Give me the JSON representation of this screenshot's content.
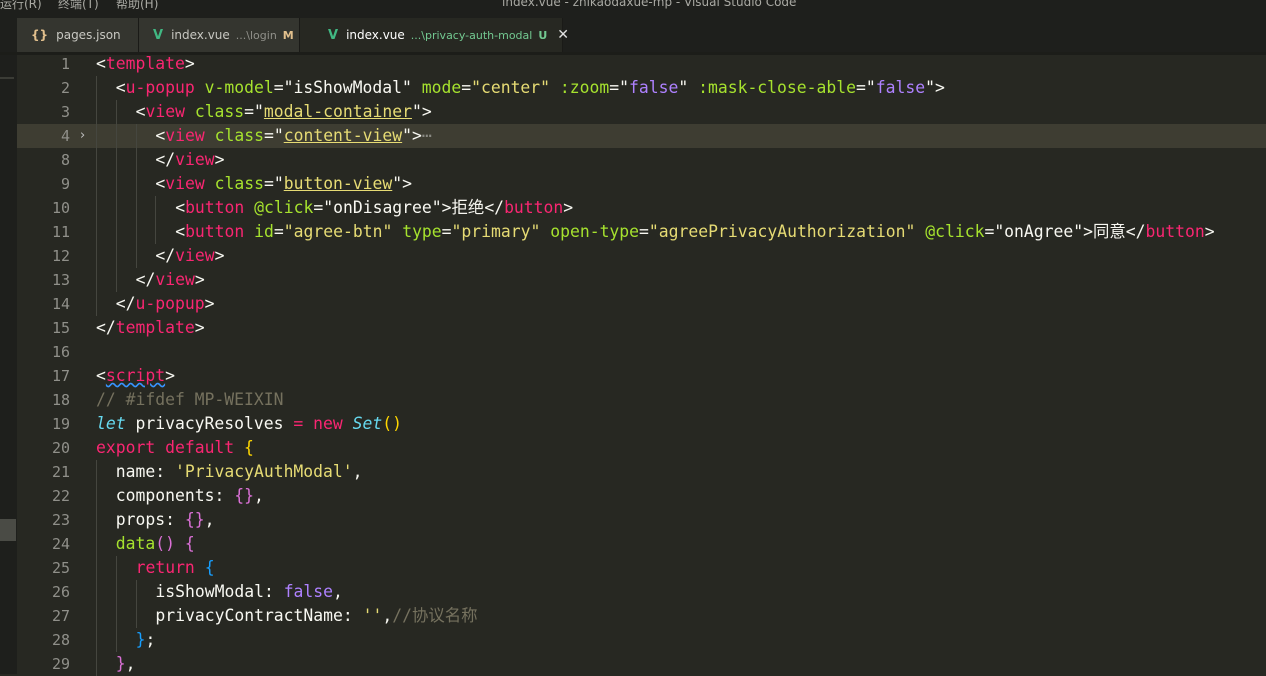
{
  "window": {
    "title": "index.vue - zhikaodaxue-mp - Visual Studio Code"
  },
  "menu": [
    "运行(R)",
    "终端(T)",
    "帮助(H)"
  ],
  "tabs": [
    {
      "icon": "json-braces-icon",
      "name": "pages.json",
      "path": "",
      "badge": "",
      "close": ""
    },
    {
      "icon": "vue-icon",
      "name": "index.vue",
      "path": "...\\login",
      "badge": "M",
      "close": ""
    },
    {
      "icon": "vue-icon",
      "name": "index.vue",
      "path": "...\\privacy-auth-modal",
      "badge": "U",
      "close": "✕"
    }
  ],
  "colors": {
    "editor_bg": "#272822",
    "tag": "#f92672",
    "attribute": "#a6e22e",
    "string": "#e6db74",
    "constant": "#ae81ff",
    "comment": "#75715e",
    "keyword_italic": "#66d9ef",
    "bracket_1": "#ffd700",
    "bracket_2": "#da70d6",
    "bracket_3": "#179fff",
    "current_line": "#3e3d32"
  },
  "lines": [
    {
      "num": "1",
      "indent": 0,
      "tokens": [
        [
          "<",
          "pu"
        ],
        [
          "template",
          "tg"
        ],
        [
          ">",
          "pu"
        ]
      ]
    },
    {
      "num": "2",
      "indent": 1,
      "tokens": [
        [
          "<",
          "pu"
        ],
        [
          "u-popup",
          "tg"
        ],
        [
          " v-model",
          "at"
        ],
        [
          "=",
          "pu"
        ],
        [
          "\"isShowModal\"",
          "pu"
        ],
        [
          " mode",
          "at"
        ],
        [
          "=",
          "pu"
        ],
        [
          "\"center\"",
          "st"
        ],
        [
          " :zoom",
          "at"
        ],
        [
          "=",
          "pu"
        ],
        [
          "\"",
          "pu"
        ],
        [
          "false",
          "cn"
        ],
        [
          "\"",
          "pu"
        ],
        [
          " :mask-close-able",
          "at"
        ],
        [
          "=",
          "pu"
        ],
        [
          "\"",
          "pu"
        ],
        [
          "false",
          "cn"
        ],
        [
          "\"",
          "pu"
        ],
        [
          ">",
          "pu"
        ]
      ]
    },
    {
      "num": "3",
      "indent": 2,
      "tokens": [
        [
          "<",
          "pu"
        ],
        [
          "view",
          "tg"
        ],
        [
          " class",
          "at"
        ],
        [
          "=",
          "pu"
        ],
        [
          "\"",
          "pu"
        ],
        [
          "modal-container",
          "st ul"
        ],
        [
          "\"",
          "pu"
        ],
        [
          ">",
          "pu"
        ]
      ]
    },
    {
      "num": "4",
      "indent": 3,
      "fold": "›",
      "highlight": true,
      "tokens": [
        [
          "<",
          "pu"
        ],
        [
          "view",
          "tg"
        ],
        [
          " class",
          "at"
        ],
        [
          "=",
          "pu"
        ],
        [
          "\"",
          "pu"
        ],
        [
          "content-view",
          "st ul"
        ],
        [
          "\"",
          "pu"
        ],
        [
          ">",
          "pu"
        ],
        [
          "⋯",
          "fd"
        ]
      ]
    },
    {
      "num": "8",
      "indent": 3,
      "tokens": [
        [
          "</",
          "pu"
        ],
        [
          "view",
          "tg"
        ],
        [
          ">",
          "pu"
        ]
      ]
    },
    {
      "num": "9",
      "indent": 3,
      "tokens": [
        [
          "<",
          "pu"
        ],
        [
          "view",
          "tg"
        ],
        [
          " class",
          "at"
        ],
        [
          "=",
          "pu"
        ],
        [
          "\"",
          "pu"
        ],
        [
          "button-view",
          "st ul"
        ],
        [
          "\"",
          "pu"
        ],
        [
          ">",
          "pu"
        ]
      ]
    },
    {
      "num": "10",
      "indent": 4,
      "tokens": [
        [
          "<",
          "pu"
        ],
        [
          "button",
          "tg"
        ],
        [
          " @click",
          "at"
        ],
        [
          "=",
          "pu"
        ],
        [
          "\"onDisagree\"",
          "pu"
        ],
        [
          ">",
          "pu"
        ],
        [
          "拒绝",
          "pu"
        ],
        [
          "</",
          "pu"
        ],
        [
          "button",
          "tg"
        ],
        [
          ">",
          "pu"
        ]
      ]
    },
    {
      "num": "11",
      "indent": 4,
      "tokens": [
        [
          "<",
          "pu"
        ],
        [
          "button",
          "tg"
        ],
        [
          " id",
          "at"
        ],
        [
          "=",
          "pu"
        ],
        [
          "\"agree-btn\"",
          "st"
        ],
        [
          " type",
          "at"
        ],
        [
          "=",
          "pu"
        ],
        [
          "\"primary\"",
          "st"
        ],
        [
          " open-type",
          "at"
        ],
        [
          "=",
          "pu"
        ],
        [
          "\"agreePrivacyAuthorization\"",
          "st"
        ],
        [
          " @click",
          "at"
        ],
        [
          "=",
          "pu"
        ],
        [
          "\"onAgree\"",
          "pu"
        ],
        [
          ">",
          "pu"
        ],
        [
          "同意",
          "pu"
        ],
        [
          "</",
          "pu"
        ],
        [
          "button",
          "tg"
        ],
        [
          ">",
          "pu"
        ]
      ]
    },
    {
      "num": "12",
      "indent": 3,
      "tokens": [
        [
          "</",
          "pu"
        ],
        [
          "view",
          "tg"
        ],
        [
          ">",
          "pu"
        ]
      ]
    },
    {
      "num": "13",
      "indent": 2,
      "tokens": [
        [
          "</",
          "pu"
        ],
        [
          "view",
          "tg"
        ],
        [
          ">",
          "pu"
        ]
      ]
    },
    {
      "num": "14",
      "indent": 1,
      "tokens": [
        [
          "</",
          "pu"
        ],
        [
          "u-popup",
          "tg"
        ],
        [
          ">",
          "pu"
        ]
      ]
    },
    {
      "num": "15",
      "indent": 0,
      "tokens": [
        [
          "</",
          "pu"
        ],
        [
          "template",
          "tg"
        ],
        [
          ">",
          "pu"
        ]
      ]
    },
    {
      "num": "16",
      "indent": 0,
      "tokens": []
    },
    {
      "num": "17",
      "indent": 0,
      "tokens": [
        [
          "<",
          "pu"
        ],
        [
          "script",
          "tg sq"
        ],
        [
          ">",
          "pu"
        ]
      ]
    },
    {
      "num": "18",
      "indent": 0,
      "tokens": [
        [
          "// #ifdef MP-WEIXIN",
          "cm"
        ]
      ]
    },
    {
      "num": "19",
      "indent": 0,
      "tokens": [
        [
          "let",
          "ital"
        ],
        [
          " privacyResolves ",
          "pu"
        ],
        [
          "=",
          "kw"
        ],
        [
          " ",
          "pu"
        ],
        [
          "new",
          "kw"
        ],
        [
          " ",
          "pu"
        ],
        [
          "Set",
          "ital"
        ],
        [
          "()",
          "br1"
        ]
      ]
    },
    {
      "num": "20",
      "indent": 0,
      "tokens": [
        [
          "export",
          "kw"
        ],
        [
          " ",
          "pu"
        ],
        [
          "default",
          "kw"
        ],
        [
          " ",
          "pu"
        ],
        [
          "{",
          "br1"
        ]
      ]
    },
    {
      "num": "21",
      "indent": 1,
      "tokens": [
        [
          "name: ",
          "pu"
        ],
        [
          "'PrivacyAuthModal'",
          "st"
        ],
        [
          ",",
          "pu"
        ]
      ]
    },
    {
      "num": "22",
      "indent": 1,
      "tokens": [
        [
          "components: ",
          "pu"
        ],
        [
          "{}",
          "br2"
        ],
        [
          ",",
          "pu"
        ]
      ]
    },
    {
      "num": "23",
      "indent": 1,
      "tokens": [
        [
          "props: ",
          "pu"
        ],
        [
          "{}",
          "br2"
        ],
        [
          ",",
          "pu"
        ]
      ]
    },
    {
      "num": "24",
      "indent": 1,
      "tokens": [
        [
          "data",
          "fn"
        ],
        [
          "()",
          "br2"
        ],
        [
          " ",
          "pu"
        ],
        [
          "{",
          "br2"
        ]
      ]
    },
    {
      "num": "25",
      "indent": 2,
      "tokens": [
        [
          "return",
          "kw"
        ],
        [
          " ",
          "pu"
        ],
        [
          "{",
          "br3"
        ]
      ]
    },
    {
      "num": "26",
      "indent": 3,
      "tokens": [
        [
          "isShowModal: ",
          "pu"
        ],
        [
          "false",
          "cn"
        ],
        [
          ",",
          "pu"
        ]
      ]
    },
    {
      "num": "27",
      "indent": 3,
      "tokens": [
        [
          "privacyContractName: ",
          "pu"
        ],
        [
          "''",
          "st"
        ],
        [
          ",",
          "pu"
        ],
        [
          "//协议名称",
          "cm"
        ]
      ]
    },
    {
      "num": "28",
      "indent": 2,
      "tokens": [
        [
          "}",
          "br3"
        ],
        [
          ";",
          "pu"
        ]
      ]
    },
    {
      "num": "29",
      "indent": 1,
      "tokens": [
        [
          "}",
          "br2"
        ],
        [
          ",",
          "pu"
        ]
      ]
    }
  ]
}
